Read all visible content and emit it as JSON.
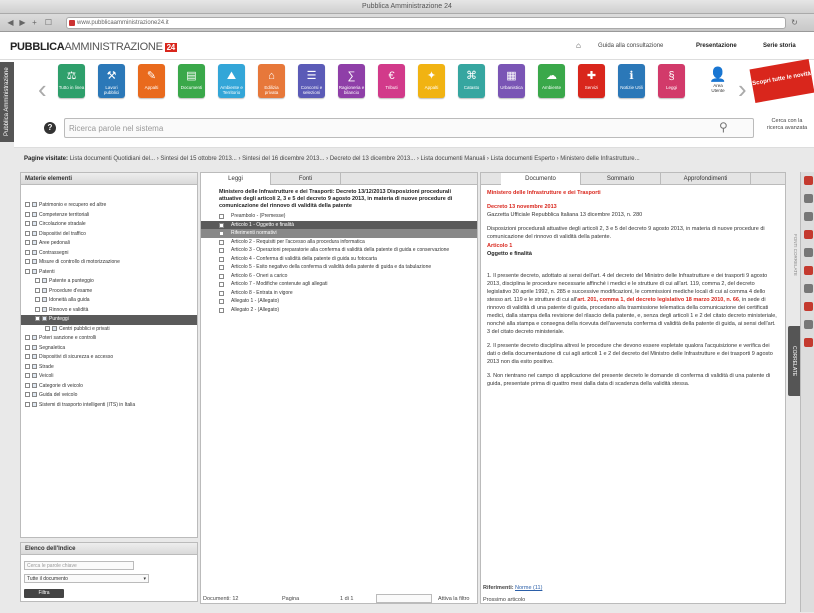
{
  "window": {
    "title": "Pubblica Amministrazione 24"
  },
  "browser": {
    "url": "www.pubblicaamministrazione24.it"
  },
  "header": {
    "logo_main": "PUBBLICA",
    "logo_sub": "AMMINISTRAZIONE",
    "logo_badge": "24",
    "links": [
      "Guida alla consultazione",
      "Presentazione",
      "Serie storia"
    ]
  },
  "sidebar_tab": "Pubblica Amministrazione",
  "toolbar": {
    "tiles": [
      {
        "label": "Tutto in linea",
        "color": "#2e9f6b",
        "glyph": "⚖"
      },
      {
        "label": "Lavori pubblici",
        "color": "#2b78b8",
        "glyph": "⚒"
      },
      {
        "label": "Appalti",
        "color": "#e96a1d",
        "glyph": "✎"
      },
      {
        "label": "Documenti",
        "color": "#3aa84a",
        "glyph": "▤"
      },
      {
        "label": "Ambiente e Territorio",
        "color": "#33a6d8",
        "glyph": "⛰"
      },
      {
        "label": "Edilizia privata",
        "color": "#e7783a",
        "glyph": "⌂"
      },
      {
        "label": "Concorsi e selezioni",
        "color": "#5b5bb7",
        "glyph": "☰"
      },
      {
        "label": "Ragioneria e bilancio",
        "color": "#8f3fa8",
        "glyph": "∑"
      },
      {
        "label": "Tributi",
        "color": "#d23a8a",
        "glyph": "€"
      },
      {
        "label": "Appalti",
        "color": "#f1b312",
        "glyph": "✦"
      },
      {
        "label": "Catasto",
        "color": "#36a6a0",
        "glyph": "⌘"
      },
      {
        "label": "Urbanistica",
        "color": "#7a55b5",
        "glyph": "▦"
      },
      {
        "label": "Ambiente",
        "color": "#3aa84a",
        "glyph": "☁"
      },
      {
        "label": "Servizi",
        "color": "#d9261c",
        "glyph": "✚"
      },
      {
        "label": "Notizie Utili",
        "color": "#2b78b8",
        "glyph": "ℹ"
      },
      {
        "label": "Leggi",
        "color": "#d23a6a",
        "glyph": "§"
      }
    ],
    "user_label": "Area Utente",
    "promo": "Scopri tutte le novità"
  },
  "search": {
    "placeholder": "Ricerca parole nel sistema",
    "advanced": "Cerca con la ricerca avanzata"
  },
  "breadcrumb": {
    "label": "Pagine visitate:",
    "path": "Lista documenti Quotidiani del... › Sintesi del 15 ottobre 2013... › Sintesi del 16 dicembre 2013... › Decreto del 13 dicembre 2013... › Lista documenti Manuali › Lista documenti Esperto › Ministero delle Infrastrutture..."
  },
  "left_panel": {
    "title": "Materie elementi",
    "items": [
      {
        "label": "Patrimonio e recupero ed altre",
        "indent": 0,
        "sel": false
      },
      {
        "label": "Competenze territoriali",
        "indent": 0,
        "sel": false
      },
      {
        "label": "Circolazione stradale",
        "indent": 0,
        "sel": false
      },
      {
        "label": "Dispositivi del traffico",
        "indent": 0,
        "sel": false
      },
      {
        "label": "Aree pedonali",
        "indent": 0,
        "sel": false
      },
      {
        "label": "Contrassegni",
        "indent": 0,
        "sel": false
      },
      {
        "label": "Misure di controllo di motorizzazione",
        "indent": 0,
        "sel": false
      },
      {
        "label": "Patenti",
        "indent": 0,
        "sel": false
      },
      {
        "label": "Patente a punteggio",
        "indent": 1,
        "sel": false
      },
      {
        "label": "Procedure d'esame",
        "indent": 1,
        "sel": false
      },
      {
        "label": "Idoneità alla guida",
        "indent": 1,
        "sel": false
      },
      {
        "label": "Rinnovo e validità",
        "indent": 1,
        "sel": false
      },
      {
        "label": "Punteggi",
        "indent": 1,
        "sel": true
      },
      {
        "label": "Centri pubblici e privati",
        "indent": 2,
        "sel": false
      },
      {
        "label": "Poteri sanzione e controlli",
        "indent": 0,
        "sel": false
      },
      {
        "label": "Segnaletica",
        "indent": 0,
        "sel": false
      },
      {
        "label": "Dispositivi di sicurezza e accesso",
        "indent": 0,
        "sel": false
      },
      {
        "label": "Strade",
        "indent": 0,
        "sel": false
      },
      {
        "label": "Veicoli",
        "indent": 0,
        "sel": false
      },
      {
        "label": "Categorie di veicolo",
        "indent": 0,
        "sel": false
      },
      {
        "label": "Guida del veicolo",
        "indent": 0,
        "sel": false
      },
      {
        "label": "Sistemi di trasporto intelligenti (ITS) in Italia",
        "indent": 0,
        "sel": false
      }
    ],
    "filter_title": "Elenco dell'Indice",
    "filter_placeholder": "Cerca le parole chiave",
    "filter_select": "Tutte il documento",
    "filter_button": "Filtra"
  },
  "middle_panel": {
    "tabs": [
      "Leggi",
      "Fonti"
    ],
    "title": "Ministero delle Infrastrutture e dei Trasporti: Decreto 13/12/2013 Disposizioni procedurali attuative degli articoli 2, 3 e 5 del decreto 9 agosto 2013, in materia di nuove procedure di comunicazione del rinnovo di validità della patente",
    "items": [
      {
        "label": "Preambolo - (Premesse)",
        "style": ""
      },
      {
        "label": "Articolo 1 - Oggetto e finalità",
        "style": "hl"
      },
      {
        "label": "Riferimenti normativi",
        "style": "hl2"
      },
      {
        "label": "Articolo 2 - Requisiti per l'accesso alla procedura informatica",
        "style": ""
      },
      {
        "label": "Articolo 3 - Operazioni preparatorie alla conferma di validità della patente di guida e conservazione",
        "style": ""
      },
      {
        "label": "Articolo 4 - Conferma di validità della patente di guida su fotocarta",
        "style": ""
      },
      {
        "label": "Articolo 5 - Esito negativo della conferma di validità della patente di guida e da tabulazione",
        "style": ""
      },
      {
        "label": "Articolo 6 - Oneri a carico",
        "style": ""
      },
      {
        "label": "Articolo 7 - Modifiche contenute agli allegati",
        "style": ""
      },
      {
        "label": "Articolo 8 - Entrata in vigore",
        "style": ""
      },
      {
        "label": "Allegato 1 - (Allegato)",
        "style": ""
      },
      {
        "label": "Allegato 2 - (Allegato)",
        "style": ""
      }
    ],
    "status_left": "Documenti: 12",
    "status_mid": "Pagina",
    "status_page": "1 di 1",
    "status_right": "Attiva la filtro"
  },
  "reader": {
    "tabs": [
      "Documento",
      "Sommario",
      "Approfondimenti"
    ],
    "heading": "Ministero delle Infrastrutture e dei Trasporti",
    "decree": "Decreto 13 novembre 2013",
    "gazette": "Gazzetta Ufficiale Repubblica Italiana 13 dicembre 2013, n. 280",
    "summary": "Disposizioni procedurali attuative degli articoli 2, 3 e 5 del decreto 9 agosto 2013, in materia di nuove procedure di comunicazione del rinnovo di validità della patente.",
    "article": "Articolo 1",
    "article_title": "Oggetto e finalità",
    "para1_a": "1. Il presente decreto, adottato ai sensi dell'art. 4 del decreto del Ministro delle Infrastrutture e dei trasporti 9 agosto 2013, disciplina le procedure necessarie affinché i medici e le strutture di cui all'art. 119, comma 2, del decreto legislativo 30 aprile 1992, n. 285 e successive modificazioni, le commissioni mediche locali di cui al comma 4 dello stesso art. 119 e le strutture di cui all'",
    "para1_red": "art. 201, comma 1, del decreto legislativo 18 marzo 2010, n. 66",
    "para1_b": ", in sede di rinnovo di validità di una patente di guida, procedano alla trasmissione telematica della comunicazione dei certificati medici, dalla stampa della revisione del rilascio della patente, e, senza degli articoli 1 e 2 del citato decreto ministeriale, nonché alla stampa e consegna della ricevuta dell'avvenuta conferma di validità della patente di guida, ai sensi dell'art. 3 del citato decreto ministeriale.",
    "para2": "2. Il presente decreto disciplina altresì le procedure che devono essere espletate qualora l'acquisizione e verifica dei dati o della documentazione di cui agli articoli 1 e 2 del decreto del Ministro delle Infrastrutture e dei trasporti 9 agosto 2013 non dia esito positivo.",
    "para3": "3. Non rientrano nel campo di applicazione del presente decreto le domande di conferma di validità di una patente di guida, presentate prima di quattro mesi dalla data di scadenza della validità stessa.",
    "footer_label": "Riferimenti:",
    "footer_link": "Norme (11)",
    "footer2": "Prossimo articolo"
  },
  "correlate": "CORRELATE",
  "fonti_vert": "FONTI CORRELATE"
}
